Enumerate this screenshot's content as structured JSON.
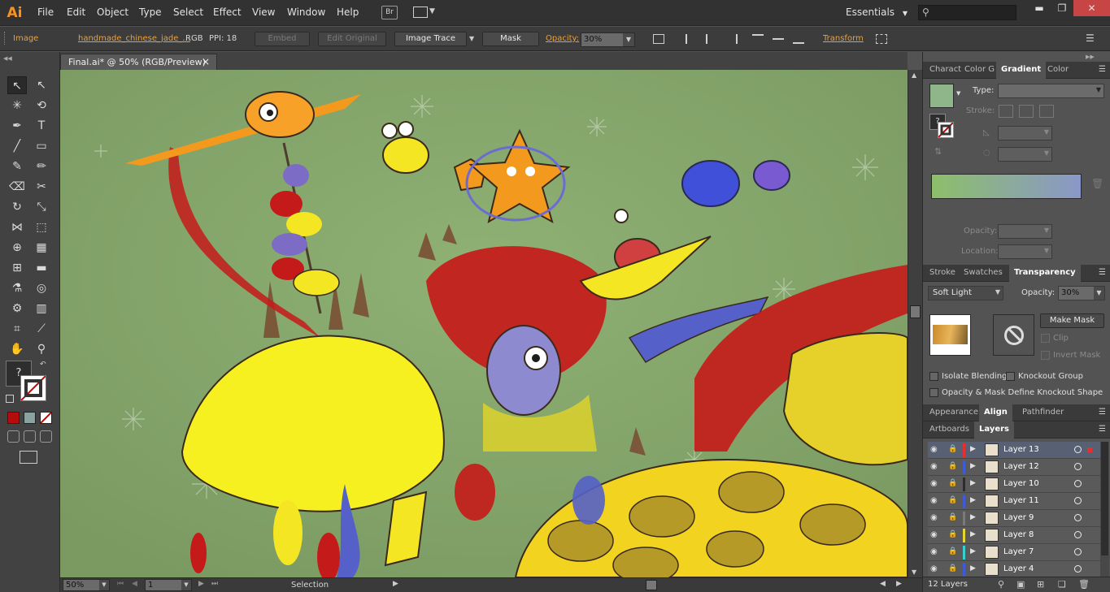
{
  "menubar": {
    "logo": "Ai",
    "items": [
      "File",
      "Edit",
      "Object",
      "Type",
      "Select",
      "Effect",
      "View",
      "Window",
      "Help"
    ],
    "bridge_label": "Br",
    "workspace": "Essentials",
    "window_buttons": [
      "▬",
      "❐",
      "✕"
    ]
  },
  "controlbar": {
    "object_type": "Image",
    "filename": "handmade_chinese_jade_...",
    "color_mode": "RGB",
    "ppi": "PPI: 18",
    "embed": "Embed",
    "edit_original": "Edit Original",
    "image_trace": "Image Trace",
    "mask": "Mask",
    "opacity_label": "Opacity:",
    "opacity_value": "30%",
    "transform": "Transform"
  },
  "document": {
    "tab_title": "Final.ai* @ 50% (RGB/Preview)",
    "tab_close": "×"
  },
  "statusbar": {
    "zoom": "50%",
    "artboard": "1",
    "tool": "Selection"
  },
  "panels": {
    "gradient_group": {
      "tabs": [
        "Charact",
        "Color G",
        "Gradient",
        "Color"
      ],
      "active": "Gradient",
      "type_label": "Type:",
      "stroke_label": "Stroke:",
      "opacity_label": "Opacity:",
      "location_label": "Location:",
      "gradient_start": "#8dbf6a",
      "gradient_end": "#8a97c8"
    },
    "transparency_group": {
      "tabs": [
        "Stroke",
        "Swatches",
        "Transparency"
      ],
      "active": "Transparency",
      "blend_mode": "Soft Light",
      "opacity_label": "Opacity:",
      "opacity_value": "30%",
      "make_mask": "Make Mask",
      "clip": "Clip",
      "invert_mask": "Invert Mask",
      "isolate_blending": "Isolate Blending",
      "knockout_group": "Knockout Group",
      "opacity_mask_define": "Opacity & Mask Define Knockout Shape"
    },
    "align_group": {
      "tabs": [
        "Appearance",
        "Align",
        "Pathfinder"
      ],
      "active": "Align"
    },
    "layers_group": {
      "tabs": [
        "Artboards",
        "Layers"
      ],
      "active": "Layers",
      "layers": [
        {
          "name": "Layer 13",
          "color": "#e53030",
          "selected": true
        },
        {
          "name": "Layer 12",
          "color": "#3d5bd6",
          "selected": false
        },
        {
          "name": "Layer 10",
          "color": "#2d2d2d",
          "selected": false
        },
        {
          "name": "Layer 11",
          "color": "#3d5bd6",
          "selected": false
        },
        {
          "name": "Layer 9",
          "color": "#7a7a7a",
          "selected": false
        },
        {
          "name": "Layer 8",
          "color": "#e6d82b",
          "selected": false
        },
        {
          "name": "Layer 7",
          "color": "#39d0d0",
          "selected": false
        },
        {
          "name": "Layer 4",
          "color": "#3d5bd6",
          "selected": false
        }
      ],
      "count": "12 Layers"
    }
  },
  "tools": {
    "fill_color": "#ffffff",
    "stroke_color": "#cc0000",
    "question_mark": "?"
  },
  "colors": {
    "accent_orange": "#f0a030",
    "canvas_green": "#86a46b"
  }
}
